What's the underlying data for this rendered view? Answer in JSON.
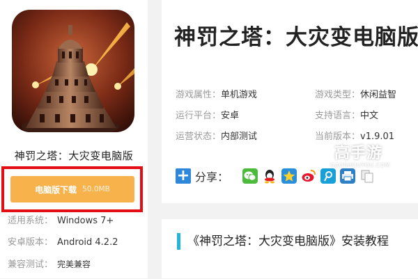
{
  "app": {
    "name": "神罚之塔：大灾变电脑版",
    "icon": "tower-game-icon"
  },
  "download": {
    "label": "电脑版下载",
    "size": "50.0MB",
    "button_color": "#f7b24b",
    "highlight_color": "#e30e15"
  },
  "meta": [
    {
      "key": "适用系统：",
      "value": "Windows 7+"
    },
    {
      "key": "安卓版本：",
      "value": "Android 4.2.2"
    },
    {
      "key": "兼容测试：",
      "value": "完美兼容"
    }
  ],
  "game": {
    "title": "神罚之塔：大灾变电脑版",
    "info": [
      {
        "key": "游戏属性：",
        "value": "单机游戏"
      },
      {
        "key": "游戏类型：",
        "value": "休闲益智"
      },
      {
        "key": "运行平台：",
        "value": "安卓"
      },
      {
        "key": "支持语言：",
        "value": "中文"
      },
      {
        "key": "运营状态：",
        "value": "内部测试"
      },
      {
        "key": "当前版本：",
        "value": "v1.9.01"
      }
    ]
  },
  "share": {
    "label": "分享：",
    "icons": [
      "wechat-icon",
      "qq-icon",
      "qzone-icon",
      "weibo-icon",
      "tencent-weibo-icon",
      "print-icon",
      "copy-icon"
    ]
  },
  "section": {
    "title": "《神罚之塔：大灾变电脑版》安装教程",
    "accent": "#21b6d9"
  },
  "watermark": {
    "text": "高手游",
    "url": "GAOSHOUYOU.COM"
  }
}
